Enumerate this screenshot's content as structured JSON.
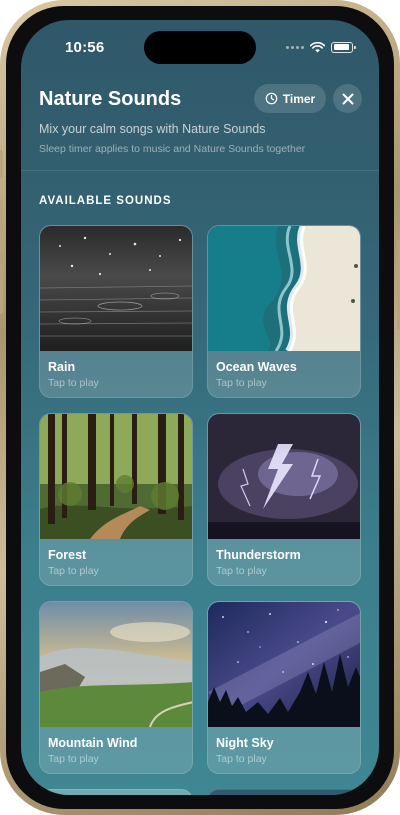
{
  "status_bar": {
    "time": "10:56"
  },
  "header": {
    "title": "Nature Sounds",
    "timer_label": "Timer",
    "subtitle": "Mix your calm songs with Nature Sounds",
    "note": "Sleep timer applies to music and Nature Sounds together"
  },
  "section": {
    "title": "AVAILABLE SOUNDS"
  },
  "sounds": [
    {
      "name": "Rain",
      "hint": "Tap to play"
    },
    {
      "name": "Ocean Waves",
      "hint": "Tap to play"
    },
    {
      "name": "Forest",
      "hint": "Tap to play"
    },
    {
      "name": "Thunderstorm",
      "hint": "Tap to play"
    },
    {
      "name": "Mountain Wind",
      "hint": "Tap to play"
    },
    {
      "name": "Night Sky",
      "hint": "Tap to play"
    }
  ],
  "colors": {
    "background_top": "#2f5869",
    "background_bottom": "#3f8792",
    "frame_gold": "#c2b08a",
    "text_primary": "#ffffff"
  },
  "icons": [
    "clock-icon",
    "close-icon",
    "wifi-icon",
    "signal-icon",
    "battery-icon"
  ]
}
